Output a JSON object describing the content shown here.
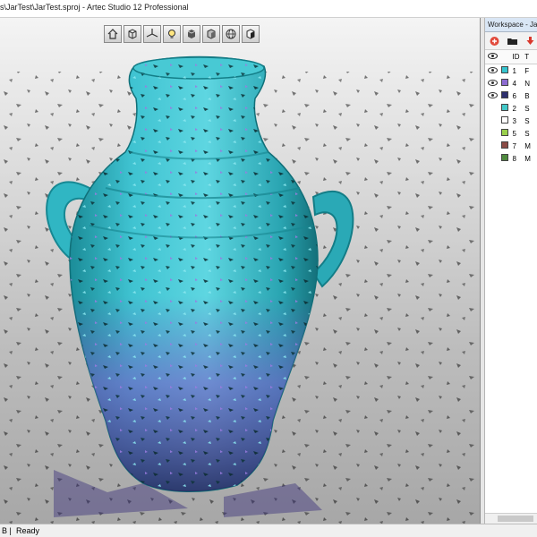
{
  "window": {
    "title": "s\\JarTest\\JarTest.sproj - Artec Studio 12 Professional"
  },
  "viewport": {
    "toolbar": [
      {
        "icon": "home-icon"
      },
      {
        "icon": "cube-icon"
      },
      {
        "icon": "axes-icon"
      },
      {
        "icon": "lightbulb-icon"
      },
      {
        "icon": "cube-solid-icon"
      },
      {
        "icon": "cube-shaded-icon"
      },
      {
        "icon": "sphere-icon"
      },
      {
        "icon": "cube-textured-icon"
      }
    ]
  },
  "workspace": {
    "title": "Workspace - JarTe",
    "columns": {
      "id": "ID",
      "name": "T"
    },
    "items": [
      {
        "id": "1",
        "name": "F",
        "visible": true,
        "color": "#35c4cf",
        "outline": false
      },
      {
        "id": "4",
        "name": "N",
        "visible": true,
        "color": "#8c6bd1",
        "outline": false
      },
      {
        "id": "6",
        "name": "B",
        "visible": true,
        "color": "#2d2f6e",
        "outline": false
      },
      {
        "id": "2",
        "name": "S",
        "visible": false,
        "color": "#42c8c8",
        "outline": false
      },
      {
        "id": "3",
        "name": "S",
        "visible": false,
        "color": "#ffffff",
        "outline": true
      },
      {
        "id": "5",
        "name": "S",
        "visible": false,
        "color": "#9ad04c",
        "outline": false
      },
      {
        "id": "7",
        "name": "M",
        "visible": false,
        "color": "#8a4b45",
        "outline": false
      },
      {
        "id": "8",
        "name": "M",
        "visible": false,
        "color": "#4f8a3e",
        "outline": false
      }
    ]
  },
  "status": {
    "memory": "B |",
    "state": "Ready"
  }
}
